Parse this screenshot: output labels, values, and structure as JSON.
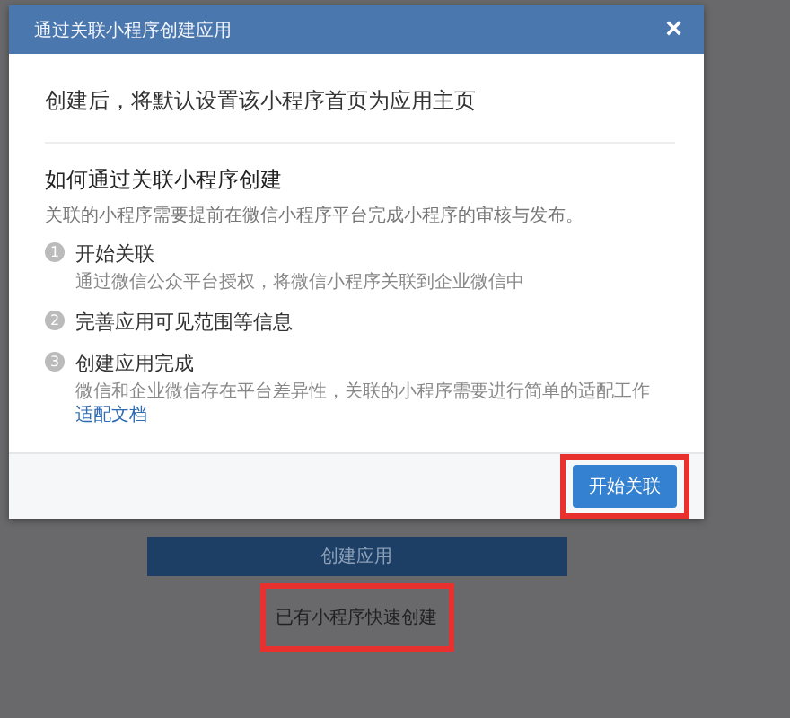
{
  "dialog": {
    "title": "通过关联小程序创建应用",
    "close": "×",
    "intro": "创建后，将默认设置该小程序首页为应用主页",
    "heading": "如何通过关联小程序创建",
    "description": "关联的小程序需要提前在微信小程序平台完成小程序的审核与发布。",
    "steps": [
      {
        "number": "1",
        "title": "开始关联",
        "detail": "通过微信公众平台授权，将微信小程序关联到企业微信中"
      },
      {
        "number": "2",
        "title": "完善应用可见范围等信息"
      },
      {
        "number": "3",
        "title": "创建应用完成",
        "detail": "微信和企业微信存在平台差异性，关联的小程序需要进行简单的适配工作",
        "link": "适配文档"
      }
    ],
    "primary_button": {
      "label": "开始关联",
      "highlighted": true
    }
  },
  "background": {
    "create_button": "创建应用",
    "quick_link": {
      "label": "已有小程序快速创建",
      "highlighted": true
    }
  }
}
